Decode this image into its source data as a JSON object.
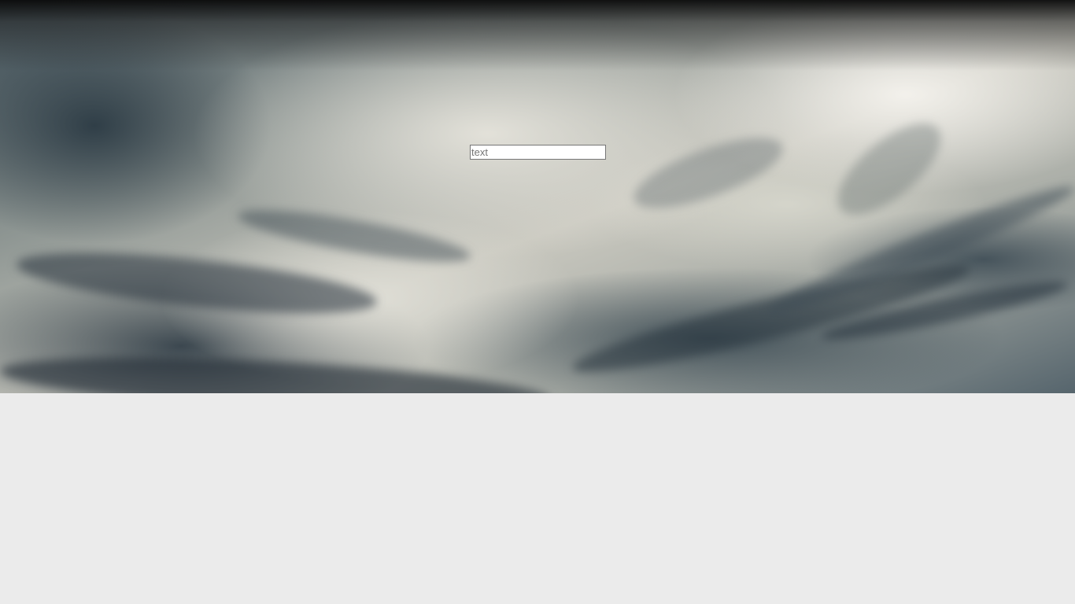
{
  "hero": {
    "background_image": "cloudy-sky-photo"
  },
  "search": {
    "value": "",
    "placeholder": "text"
  },
  "colors": {
    "page_background": "#ebebeb",
    "input_border": "#767676",
    "input_background": "#ffffff"
  }
}
